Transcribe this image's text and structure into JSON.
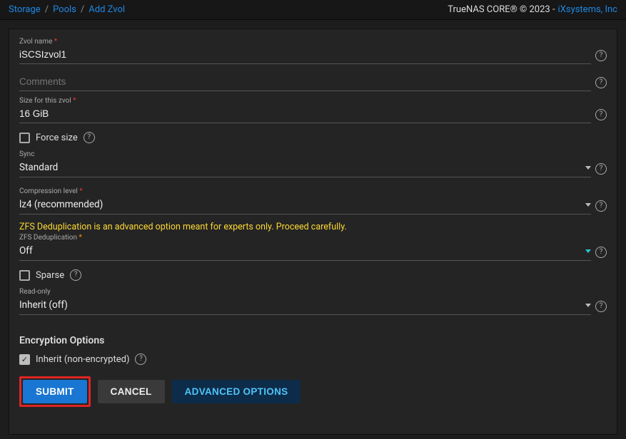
{
  "breadcrumb": {
    "storage": "Storage",
    "pools": "Pools",
    "add_zvol": "Add Zvol"
  },
  "copyright": {
    "product": "TrueNAS CORE® © 2023 -",
    "vendor": "iXsystems, Inc"
  },
  "fields": {
    "zvol_name": {
      "label": "Zvol name",
      "value": "iSCSIzvol1"
    },
    "comments": {
      "label": "Comments",
      "value": ""
    },
    "size": {
      "label": "Size for this zvol",
      "value": "16 GiB"
    },
    "force_size": {
      "label": "Force size"
    },
    "sync": {
      "label": "Sync",
      "value": "Standard"
    },
    "compression": {
      "label": "Compression level",
      "value": "lz4 (recommended)"
    },
    "dedup_warning": "ZFS Deduplication is an advanced option meant for experts only. Proceed carefully.",
    "dedup": {
      "label": "ZFS Deduplication",
      "value": "Off"
    },
    "sparse": {
      "label": "Sparse"
    },
    "readonly": {
      "label": "Read-only",
      "value": "Inherit (off)"
    }
  },
  "encryption": {
    "title": "Encryption Options",
    "inherit_label": "Inherit (non-encrypted)"
  },
  "buttons": {
    "submit": "SUBMIT",
    "cancel": "CANCEL",
    "advanced": "ADVANCED OPTIONS"
  }
}
